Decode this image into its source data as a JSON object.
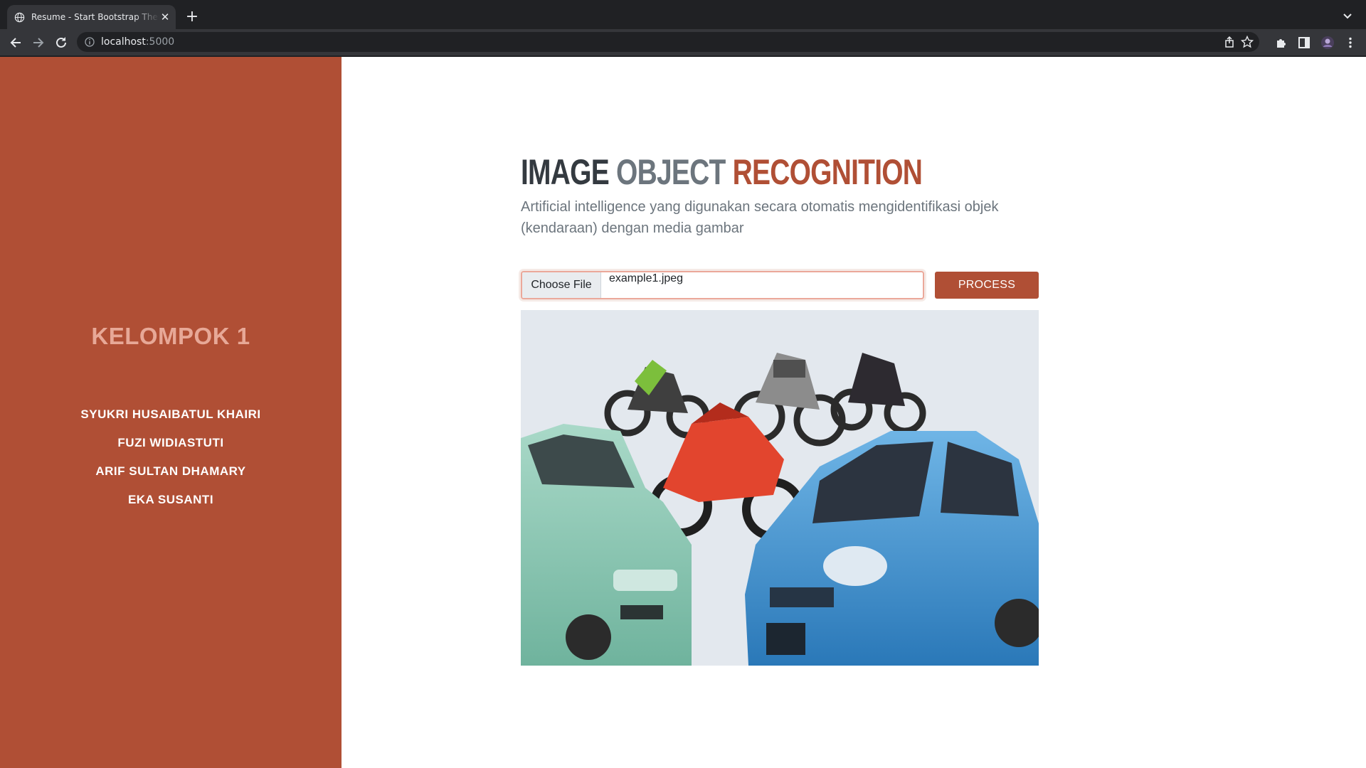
{
  "browser": {
    "tab_title": "Resume - Start Bootstrap Theme",
    "url_host": "localhost",
    "url_port": ":5000"
  },
  "sidebar": {
    "brand": "KELOMPOK 1",
    "members": [
      {
        "label": "SYUKRI HUSAIBATUL KHAIRI"
      },
      {
        "label": "FUZI WIDIASTUTI"
      },
      {
        "label": "ARIF SULTAN DHAMARY"
      },
      {
        "label": "EKA SUSANTI"
      }
    ]
  },
  "main": {
    "heading": {
      "part1": "IMAGE",
      "part2": "OBJECT",
      "part3": "RECOGNITION"
    },
    "subtitle": "Artificial intelligence yang digunakan secara otomatis mengidentifikasi objek (kendaraan) dengan media gambar",
    "file_input": {
      "button_label": "Choose File",
      "file_name": "example1.jpeg"
    },
    "process_label": "PROCESS"
  },
  "colors": {
    "accent": "#b04f35",
    "brand_text": "#e7a897",
    "heading_dark": "#343a40",
    "heading_gray": "#6c757d"
  },
  "icons": [
    "globe-icon",
    "close-icon",
    "plus-icon",
    "chevron-down-icon",
    "back-arrow-icon",
    "forward-arrow-icon",
    "reload-icon",
    "info-icon",
    "share-icon",
    "star-icon",
    "puzzle-icon",
    "side-panel-icon",
    "avatar",
    "more-vert-icon"
  ]
}
